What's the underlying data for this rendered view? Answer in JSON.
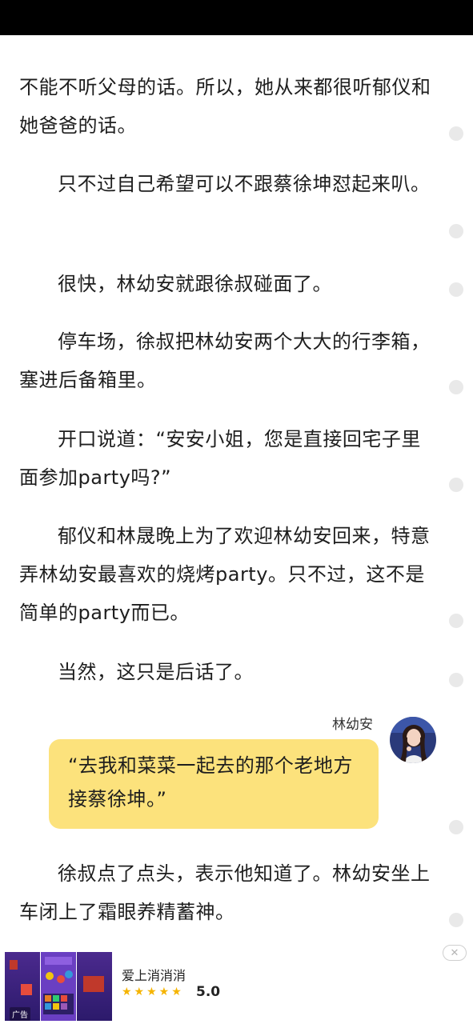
{
  "reader": {
    "paragraphs": [
      "不能不听父母的话。所以，她从来都很听郁仪和她爸爸的话。",
      "只不过自己希望可以不跟蔡徐坤怼起来叭。",
      "很快，林幼安就跟徐叔碰面了。",
      "停车场，徐叔把林幼安两个大大的行李箱，塞进后备箱里。",
      "开口说道：“安安小姐，您是直接回宅子里面参加party吗?”",
      "郁仪和林晟晚上为了欢迎林幼安回来，特意弄林幼安最喜欢的烧烤party。只不过，这不是简单的party而已。",
      "当然，这只是后话了。"
    ],
    "dialogue": {
      "speaker": "林幼安",
      "text": "“去我和菜菜一起去的那个老地方接蔡徐坤。”"
    },
    "after_paragraph": "徐叔点了点头，表示他知道了。林幼安坐上车闭上了霜眼养精蓄神。"
  },
  "ad": {
    "tag": "广告",
    "title": "爱上消消消",
    "stars": "★★★★★",
    "rating": "5.0",
    "close_icon": "close-icon"
  },
  "colors": {
    "bubble": "#fce27c",
    "status_bar": "#000000",
    "star": "#f5b400"
  }
}
